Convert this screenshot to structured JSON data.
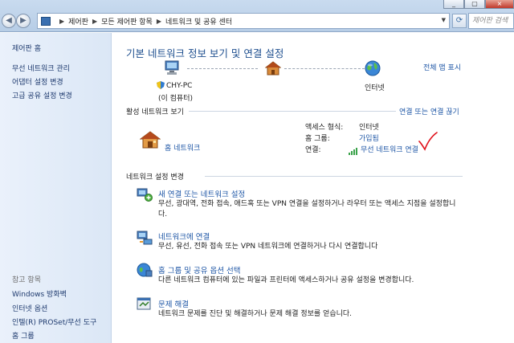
{
  "window": {
    "minimize_label": "_",
    "close_label": "×"
  },
  "nav": {
    "back_label": "◀",
    "forward_label": "▶"
  },
  "address": {
    "breadcrumbs": [
      "제어판",
      "모든 제어판 항목",
      "네트워크 및 공유 센터"
    ]
  },
  "search": {
    "placeholder": "제어판 검색"
  },
  "sidebar": {
    "items": [
      "제어판 홈",
      "무선 네트워크 관리",
      "어댑터 설정 변경",
      "고급 공유 설정 변경"
    ],
    "see_also_title": "참고 항목",
    "see_also": [
      "Windows 방화벽",
      "인터넷 옵션",
      "인텔(R) PROSet/무선 도구",
      "홈 그룹"
    ]
  },
  "main": {
    "title": "기본 네트워크 정보 보기 및 연결 설정",
    "view_full_map": "전체 맵 표시",
    "computer_name": "CHY-PC",
    "computer_sub": "(이 컴퓨터)",
    "internet_label": "인터넷",
    "active_title": "활성 네트워크 보기",
    "connect_disconnect": "연결 또는 연결 끊기",
    "network_name": "홈 네트워크",
    "access_type_label": "액세스 형식:",
    "access_type_value": "인터넷",
    "homegroup_label": "홈 그룹:",
    "homegroup_value": "가입됨",
    "connection_label": "연결:",
    "connection_value": "무선 네트워크 연결",
    "change_title": "네트워크 설정 변경",
    "tasks": [
      {
        "title": "새 연결 또는 네트워크 설정",
        "desc": "무선, 광대역, 전화 접속, 애드혹 또는 VPN 연결을 설정하거나 라우터 또는 액세스 지점을 설정합니다."
      },
      {
        "title": "네트워크에 연결",
        "desc": "무선, 유선, 전화 접속 또는 VPN 네트워크에 연결하거나 다시 연결합니다"
      },
      {
        "title": "홈 그룹 및 공유 옵션 선택",
        "desc": "다른 네트워크 컴퓨터에 있는 파일과 프린터에 액세스하거나 공유 설정을 변경합니다."
      },
      {
        "title": "문제 해결",
        "desc": "네트워크 문제를 진단 및 해결하거나 문제 해결 정보를 얻습니다."
      }
    ]
  }
}
